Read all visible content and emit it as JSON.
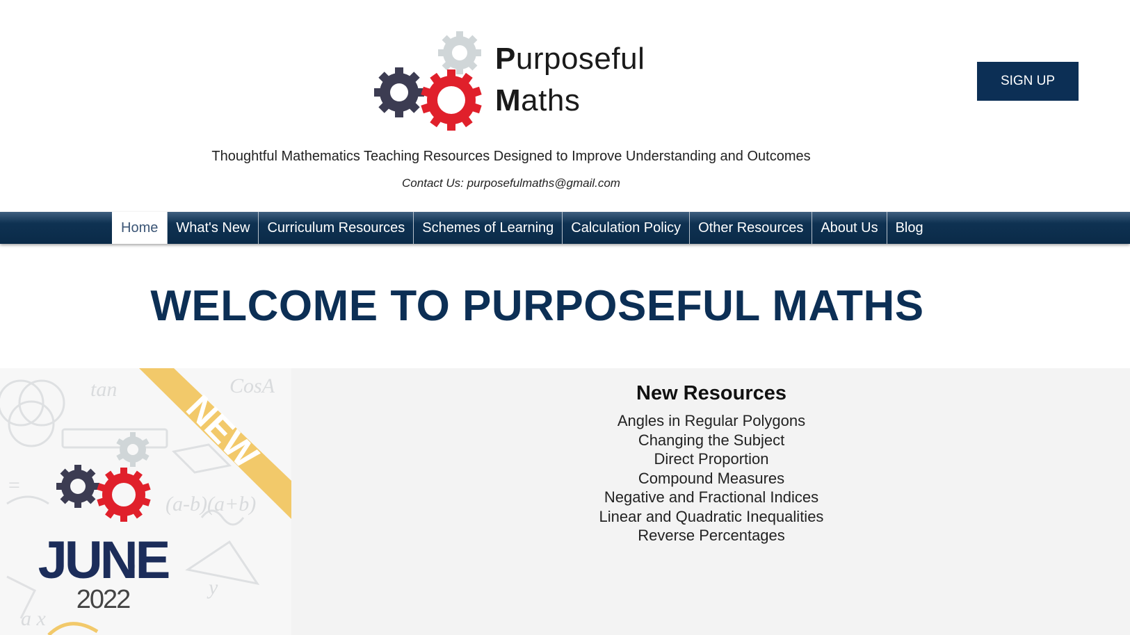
{
  "brand": {
    "name_line1_initial": "P",
    "name_line1_rest": "urposeful",
    "name_line2_initial": "M",
    "name_line2_rest": "aths",
    "tagline": "Thoughtful Mathematics Teaching Resources Designed to Improve Understanding and Outcomes",
    "contact": "Contact Us: purposefulmaths@gmail.com",
    "logo_icon": "gears-logo-icon",
    "colors": {
      "dark_gear": "#3c3c52",
      "red_gear": "#e0202b",
      "light_gear": "#d0d6d8"
    }
  },
  "header": {
    "signup_label": "SIGN UP"
  },
  "nav": {
    "items": [
      {
        "label": "Home",
        "active": true
      },
      {
        "label": "What's New"
      },
      {
        "label": "Curriculum Resources"
      },
      {
        "label": "Schemes of Learning"
      },
      {
        "label": "Calculation Policy"
      },
      {
        "label": "Other Resources"
      },
      {
        "label": "About Us"
      },
      {
        "label": "Blog"
      }
    ]
  },
  "main": {
    "welcome_title": "WELCOME TO PURPOSEFUL MATHS"
  },
  "promo": {
    "ribbon_label": "NEW",
    "month": "JUNE",
    "year": "2022",
    "ribbon_color": "#f2c96a",
    "month_color": "#1c2d5a"
  },
  "resources": {
    "title": "New Resources",
    "items": [
      "Angles in Regular Polygons",
      "Changing the Subject",
      "Direct Proportion",
      "Compound Measures",
      "Negative and Fractional Indices",
      "Linear and Quadratic Inequalities",
      "Reverse Percentages"
    ]
  },
  "colors": {
    "navy": "#0c2f55",
    "panel": "#f3f3f3"
  }
}
